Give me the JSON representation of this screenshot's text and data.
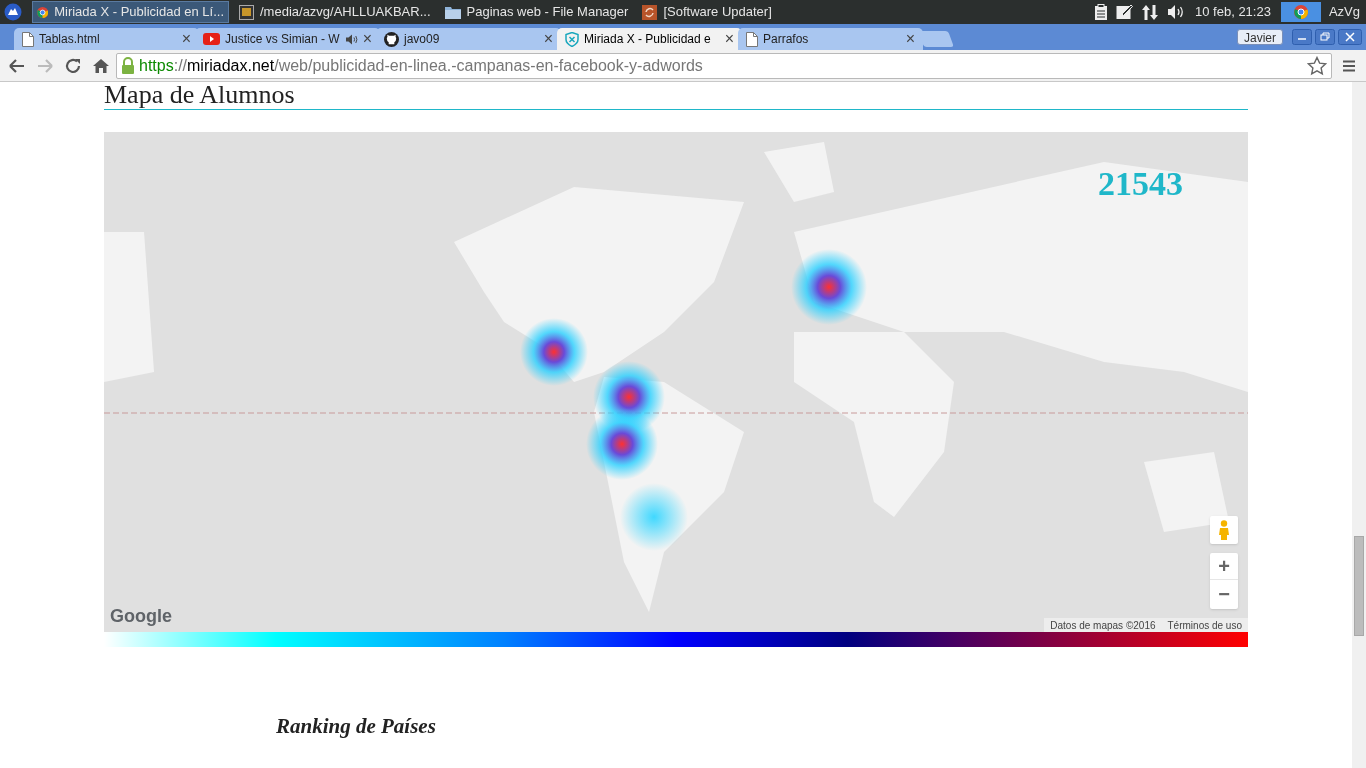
{
  "taskbar": {
    "tasks": [
      {
        "label": "Miriada X - Publicidad en Lí...",
        "selected": true
      },
      {
        "label": "/media/azvg/AHLLUAKBAR...",
        "selected": false
      },
      {
        "label": "Paginas web - File Manager",
        "selected": false
      },
      {
        "label": "[Software Updater]",
        "selected": false
      }
    ],
    "clock": "10 feb, 21:23",
    "user": "AzVg"
  },
  "browser": {
    "tabs": [
      {
        "title": "Tablas.html",
        "selected": false,
        "playing_audio": false
      },
      {
        "title": "Justice vs Simian - W",
        "selected": false,
        "playing_audio": true
      },
      {
        "title": "javo09",
        "selected": false,
        "playing_audio": false
      },
      {
        "title": "Miriada X - Publicidad e",
        "selected": true,
        "playing_audio": false
      },
      {
        "title": "Parrafos",
        "selected": false,
        "playing_audio": false
      }
    ],
    "close_glyph": "×",
    "profile": "Javier",
    "url": {
      "scheme": "https",
      "separator": "://",
      "host": "miriadax.net",
      "path": "/web/publicidad-en-linea.-campanas-en-facebook-y-adwords"
    }
  },
  "page": {
    "heading": "Mapa de Alumnos",
    "map": {
      "student_count": "21543",
      "logo": "Google",
      "zoom_in": "+",
      "zoom_out": "−",
      "attribution": "Datos de mapas ©2016",
      "terms": "Términos de uso"
    },
    "ranking_title": "Ranking de Países"
  }
}
